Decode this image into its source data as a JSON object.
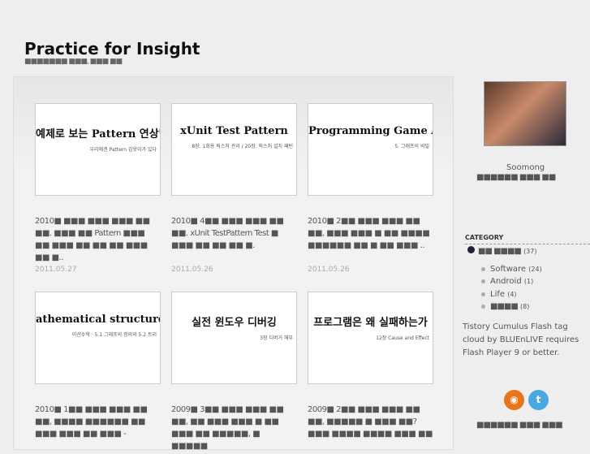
{
  "header": {
    "title": "Practice for Insight",
    "subtitle": "■■■■■■■ ■■■, ■■■ ■■"
  },
  "posts": [
    {
      "thumb_title": "예제로 보는 Pattern 연상법",
      "thumb_sub": "우리에겐 Pattern 갑옷이가 있다",
      "excerpt": "2010■ ■■■ ■■■ ■■■ ■■ ■■. ■■■ ■■ Pattern ■■■ ■■ ■■■ ■■ ■■ ■■ ■■■ ■■ ■..",
      "date": "2011.05.27"
    },
    {
      "thumb_title": "xUnit Test Pattern",
      "thumb_sub": "8장. 1회용 픽스처 관리 / 20장. 픽스처 설치 패턴",
      "excerpt": "2010■ 4■■ ■■■ ■■■ ■■ ■■. xUnit TestPattern Test ■ ■■■ ■■ ■■ ■■ ■.",
      "date": "2011.05.26"
    },
    {
      "thumb_title": "Programming Game AI by Example",
      "thumb_sub": "5. 그래프의 비밀",
      "excerpt": "2010■ 2■■ ■■■ ■■■ ■■ ■■, ■■■ ■■■ ■ ■■ ■■■■ ■■■■■■ ■■ ■ ■■ ■■■ ..",
      "date": "2011.05.26"
    },
    {
      "thumb_title": "athematical structure for Computer Science",
      "thumb_sub": "이산수학 · 5.1 그래프의 정의와 5.2 트리",
      "excerpt": "2010■ 1■■ ■■■ ■■■ ■■ ■■, ■■■■ ■■■■■■ ■■ ■■■ ■■■ ■■ ■■■ -",
      "date": ""
    },
    {
      "thumb_title": "실전 윈도우 디버깅",
      "thumb_sub": "3장 디버거 해부",
      "excerpt": "2009■ 3■■ ■■■ ■■■ ■■ ■■, ■■ ■■■ ■■■ ■ ■■ ■■■ ■■ ■■■■■, ■ ■■■■■",
      "date": ""
    },
    {
      "thumb_title": "프로그램은 왜 실패하는가",
      "thumb_sub": "12장 Cause and Effect",
      "excerpt": "2009■ 2■■ ■■■ ■■■ ■■ ■■, ■■■■■ ■ ■■■ ■■? ■■■ ■■■■ ■■■■ ■■■ ■■",
      "date": ""
    }
  ],
  "sidebar": {
    "name": "Soomong",
    "tagline": "■■■■■■ ■■■ ■■",
    "category_title": "CATEGORY",
    "categories": [
      {
        "label": "■■ ■■■■",
        "count": "(37)"
      },
      {
        "label": "Software",
        "count": "(24)"
      },
      {
        "label": "Android",
        "count": "(1)"
      },
      {
        "label": "Life",
        "count": "(4)"
      },
      {
        "label": "■■■■",
        "count": "(8)"
      }
    ],
    "flash_note": "Tistory Cumulus Flash tag cloud by BLUEnLIVE requires Flash Player 9 or better.",
    "footer": "■■■■■■ ■■■ ■■■"
  }
}
